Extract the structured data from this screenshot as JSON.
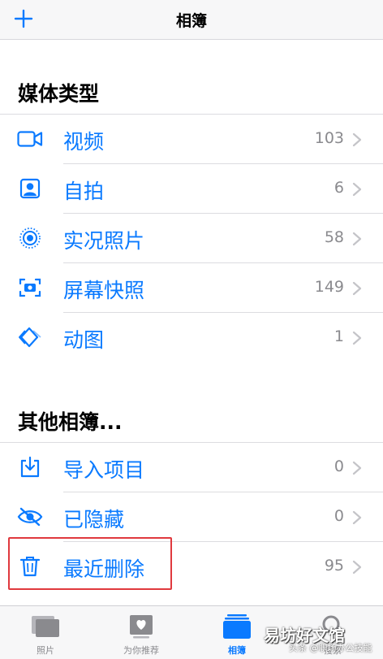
{
  "navbar": {
    "title": "相簿",
    "add_icon": "plus-icon"
  },
  "sections": [
    {
      "title": "媒体类型",
      "items": [
        {
          "label": "视频",
          "count": "103",
          "icon": "video-icon"
        },
        {
          "label": "自拍",
          "count": "6",
          "icon": "portrait-icon"
        },
        {
          "label": "实况照片",
          "count": "58",
          "icon": "live-photo-icon"
        },
        {
          "label": "屏幕快照",
          "count": "149",
          "icon": "screenshot-icon"
        },
        {
          "label": "动图",
          "count": "1",
          "icon": "animated-icon"
        }
      ]
    },
    {
      "title": "其他相簿...",
      "items": [
        {
          "label": "导入项目",
          "count": "0",
          "icon": "import-icon"
        },
        {
          "label": "已隐藏",
          "count": "0",
          "icon": "hidden-eye-icon"
        },
        {
          "label": "最近删除",
          "count": "95",
          "icon": "trash-icon"
        }
      ]
    }
  ],
  "tabbar": {
    "tabs": [
      {
        "label": "照片",
        "icon": "photos-tab-icon",
        "active": false
      },
      {
        "label": "为你推荐",
        "icon": "for-you-tab-icon",
        "active": false
      },
      {
        "label": "相簿",
        "icon": "albums-tab-icon",
        "active": true
      },
      {
        "label": "搜索",
        "icon": "search-tab-icon",
        "active": false
      }
    ]
  },
  "watermark": {
    "main": "易坊好文馆",
    "sub": "头条 @职场办公技能"
  },
  "colors": {
    "accent": "#0a7aff",
    "highlight_box": "#e0393e",
    "secondary_text": "#8a8a8e"
  }
}
